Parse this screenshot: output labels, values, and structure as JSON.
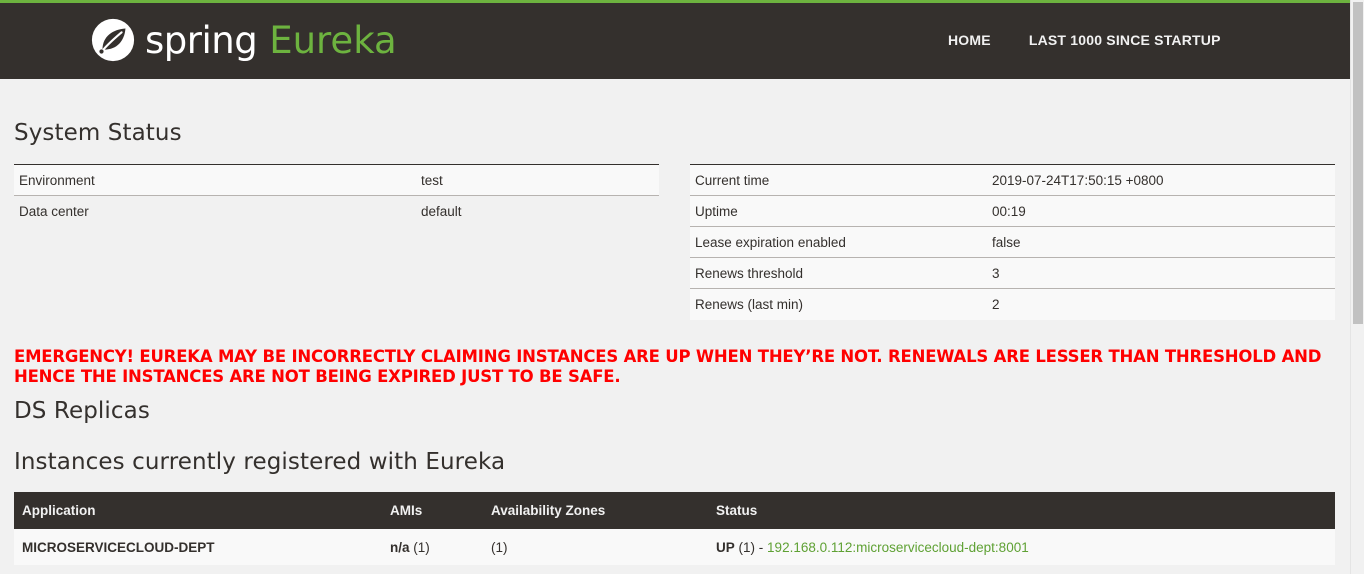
{
  "brand": {
    "spring": "spring",
    "eureka": "Eureka",
    "accent": "#6db33f",
    "dark": "#34302d",
    "emergency_color": "#ff0000"
  },
  "nav": {
    "home": "HOME",
    "last1000": "LAST 1000 SINCE STARTUP"
  },
  "system_status": {
    "title": "System Status",
    "left": [
      {
        "label": "Environment",
        "value": "test"
      },
      {
        "label": "Data center",
        "value": "default"
      }
    ],
    "right": [
      {
        "label": "Current time",
        "value": "2019-07-24T17:50:15 +0800"
      },
      {
        "label": "Uptime",
        "value": "00:19"
      },
      {
        "label": "Lease expiration enabled",
        "value": "false"
      },
      {
        "label": "Renews threshold",
        "value": "3"
      },
      {
        "label": "Renews (last min)",
        "value": "2"
      }
    ]
  },
  "emergency": "EMERGENCY! EUREKA MAY BE INCORRECTLY CLAIMING INSTANCES ARE UP WHEN THEY’RE NOT. RENEWALS ARE LESSER THAN THRESHOLD AND HENCE THE INSTANCES ARE NOT BEING EXPIRED JUST TO BE SAFE.",
  "ds_replicas": {
    "title": "DS Replicas"
  },
  "instances": {
    "title": "Instances currently registered with Eureka",
    "headers": {
      "application": "Application",
      "amis": "AMIs",
      "zones": "Availability Zones",
      "status": "Status"
    },
    "rows": [
      {
        "application": "MICROSERVICECLOUD-DEPT",
        "amis_bold": "n/a",
        "amis_count": "(1)",
        "zones": "(1)",
        "status_bold": "UP",
        "status_count": "(1) -",
        "instance_link": "192.168.0.112:microservicecloud-dept:8001"
      }
    ]
  }
}
